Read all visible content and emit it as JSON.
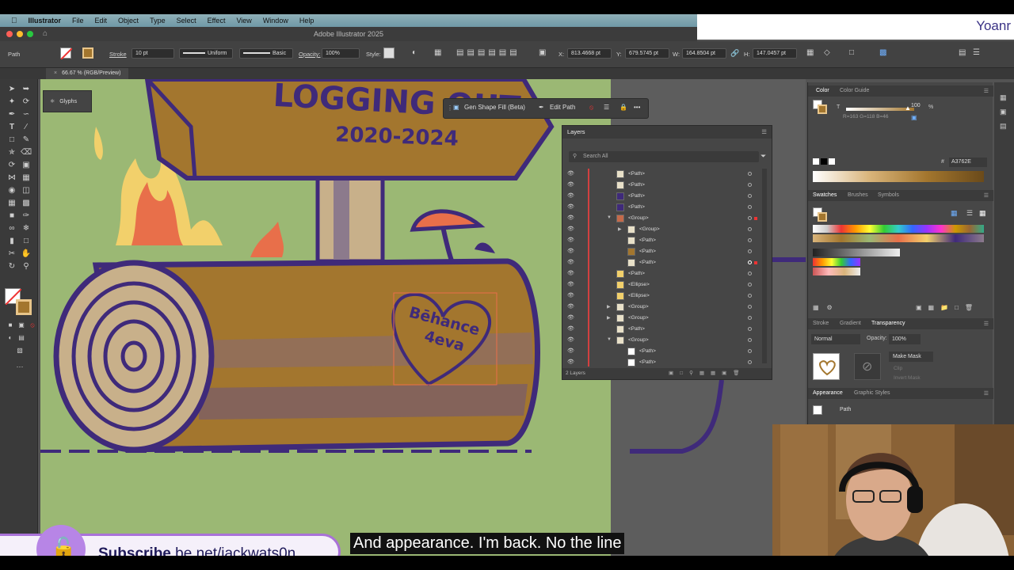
{
  "menubar": {
    "apple": "",
    "items": [
      "Illustrator",
      "File",
      "Edit",
      "Object",
      "Type",
      "Select",
      "Effect",
      "View",
      "Window",
      "Help"
    ]
  },
  "overlay_name": "Yoanr",
  "window_title": "Adobe Illustrator 2025",
  "controlbar": {
    "selection_type": "Path",
    "stroke_label": "Stroke",
    "stroke_weight": "10 pt",
    "profile": "Uniform",
    "brush": "Basic",
    "opacity_label": "Opacity:",
    "opacity_value": "100%",
    "style_label": "Style:",
    "x_label": "X:",
    "x_value": "813.4668 pt",
    "y_label": "Y:",
    "y_value": "679.5745 pt",
    "w_label": "W:",
    "w_value": "164.8504 pt",
    "h_label": "H:",
    "h_value": "147.0457 pt"
  },
  "document_tab": "66.67 % (RGB/Preview)",
  "glyphs_panel": "Glyphs",
  "context_bar": {
    "gen_shape_fill": "Gen Shape Fill (Beta)",
    "edit_path": "Edit Path",
    "more": "•••"
  },
  "artwork": {
    "sign_line1": "LOGGING OUT",
    "sign_line2": "2020-2024",
    "heart_line1": "Bēhance",
    "heart_line2": "4eva"
  },
  "layers": {
    "title": "Layers",
    "search_placeholder": "Search All",
    "rows": [
      "<Path>",
      "<Path>",
      "<Path>",
      "<Path>",
      "<Group>",
      "<Group>",
      "<Path>",
      "<Path>",
      "<Path>",
      "<Path>",
      "<Ellipse>",
      "<Ellipse>",
      "<Group>",
      "<Group>",
      "<Path>",
      "<Group>",
      "<Path>",
      "<Path>"
    ],
    "footer": "2 Layers"
  },
  "color_panel": {
    "tabs": [
      "Color",
      "Color Guide"
    ],
    "slider_label": "T",
    "slider_value": "100",
    "percent": "%",
    "rgb_readout": "R=163 G=118 B=46",
    "hex_label": "#",
    "hex_value": "A3762E"
  },
  "swatches_panel": {
    "tabs": [
      "Swatches",
      "Brushes",
      "Symbols"
    ]
  },
  "transparency_panel": {
    "tabs": [
      "Stroke",
      "Gradient",
      "Transparency"
    ],
    "blend_mode": "Normal",
    "opacity_label": "Opacity:",
    "opacity_value": "100%",
    "make_mask": "Make Mask",
    "clip": "Clip",
    "invert_mask": "Invert Mask"
  },
  "appearance_panel": {
    "tabs": [
      "Appearance",
      "Graphic Styles"
    ],
    "item": "Path"
  },
  "subscribe": {
    "bold": "Subscribe",
    "rest": " be.net/jackwats0n"
  },
  "caption": "And appearance. I'm back. No the line",
  "colors": {
    "canvas": "#9bb874",
    "log": "#a3762e",
    "outline": "#3f2a7a",
    "accent": "#a972d8"
  }
}
